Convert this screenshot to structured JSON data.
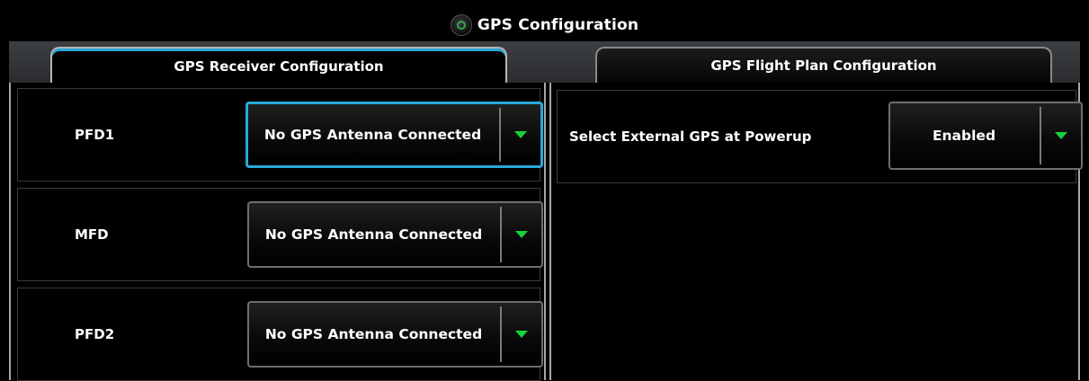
{
  "window": {
    "title": "GPS Configuration",
    "title_icon": "garmin-globe-icon"
  },
  "tabs": [
    {
      "label": "GPS Receiver Configuration",
      "active": true
    },
    {
      "label": "GPS Flight Plan Configuration",
      "active": false
    }
  ],
  "receiver_rows": [
    {
      "label": "PFD1",
      "value": "No GPS Antenna Connected",
      "focused": true
    },
    {
      "label": "MFD",
      "value": "No GPS Antenna Connected",
      "focused": false
    },
    {
      "label": "PFD2",
      "value": "No GPS Antenna Connected",
      "focused": false
    }
  ],
  "flight_plan_rows": [
    {
      "label": "Select External GPS at Powerup",
      "value": "Enabled"
    }
  ],
  "colors": {
    "focus": "#29a9d9",
    "arrow": "#16d33c",
    "tab_accent": "#27a7d6"
  }
}
